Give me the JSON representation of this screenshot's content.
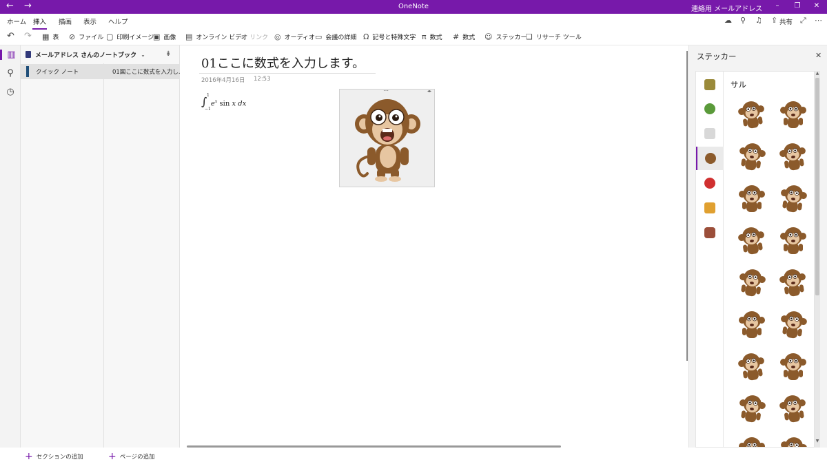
{
  "titlebar": {
    "back_glyph": "←",
    "forward_glyph": "→",
    "app_title": "OneNote",
    "account_name": "連絡用 メールアドレス",
    "minimize_glyph": "–",
    "restore_glyph": "❐",
    "close_glyph": "✕",
    "color": "#7719aa"
  },
  "menu": {
    "tabs": [
      {
        "label": "ホーム"
      },
      {
        "label": "挿入",
        "active": true
      },
      {
        "label": "描画"
      },
      {
        "label": "表示"
      },
      {
        "label": "ヘルプ"
      }
    ],
    "share_label": "共有",
    "icons": [
      "cloud-sync-icon",
      "lightbulb-icon",
      "bell-icon",
      "share-icon",
      "expand-icon",
      "more-icon"
    ]
  },
  "ribbon": {
    "items": [
      {
        "label": "表",
        "icon": "table-icon",
        "glyph": "▦"
      },
      {
        "label": "ファイル",
        "icon": "paperclip-icon",
        "glyph": "⊘"
      },
      {
        "label": "印刷イメージ",
        "icon": "document-icon",
        "glyph": "▢"
      },
      {
        "label": "画像",
        "icon": "picture-icon",
        "glyph": "▣"
      },
      {
        "label": "オンライン ビデオ",
        "icon": "online-video-icon",
        "glyph": "▤"
      },
      {
        "label": "リンク",
        "icon": "link-icon",
        "glyph": "∞",
        "disabled": true
      },
      {
        "label": "オーディオ",
        "icon": "audio-icon",
        "glyph": "◎"
      },
      {
        "label": "会議の詳細",
        "icon": "meeting-icon",
        "glyph": "▭"
      },
      {
        "label": "記号と特殊文字",
        "icon": "omega-icon",
        "glyph": "Ω"
      },
      {
        "label": "数式",
        "icon": "pi-icon",
        "glyph": "π"
      },
      {
        "label": "数式",
        "icon": "ink-math-icon",
        "glyph": "#"
      },
      {
        "label": "ステッカー",
        "icon": "smiley-icon",
        "glyph": "☺"
      },
      {
        "label": "リサーチ ツール",
        "icon": "research-icon",
        "glyph": "❏"
      }
    ]
  },
  "navpane": {
    "notebook_title": "メールアドレス さんのノートブック",
    "sections": [
      {
        "label": "クイック ノート",
        "color": "#1f4e79"
      }
    ],
    "pages": [
      {
        "label": "01図ここに数式を入力し..."
      }
    ],
    "add_section_label": "セクションの追加",
    "add_page_label": "ページの追加"
  },
  "page": {
    "title": "01ここに数式を入力します。",
    "date": "2016年4月16日",
    "time": "12:53",
    "equation": {
      "upper": "1",
      "lower": "−1",
      "exp": "x",
      "base": "e",
      "func": "sin",
      "var": "x",
      "diff": "dx"
    }
  },
  "sticker_panel": {
    "title": "ステッカー",
    "close_glyph": "✕",
    "selected_category": "サル",
    "category_icons": [
      "nature-sticker-icon",
      "plant-sticker-icon",
      "cup-sticker-icon",
      "monkey-sticker-icon",
      "apple-sticker-icon",
      "food-sticker-icon",
      "bear-sticker-icon"
    ],
    "category_colors": [
      "#9a8a3a",
      "#5a9a3a",
      "#cfcfcf",
      "#8b5a2b",
      "#d03030",
      "#e0a030",
      "#9b4e3a"
    ]
  },
  "colors": {
    "accent": "#7719aa",
    "monkey_brown": "#8b5a2b",
    "monkey_face": "#e7c6a1"
  }
}
